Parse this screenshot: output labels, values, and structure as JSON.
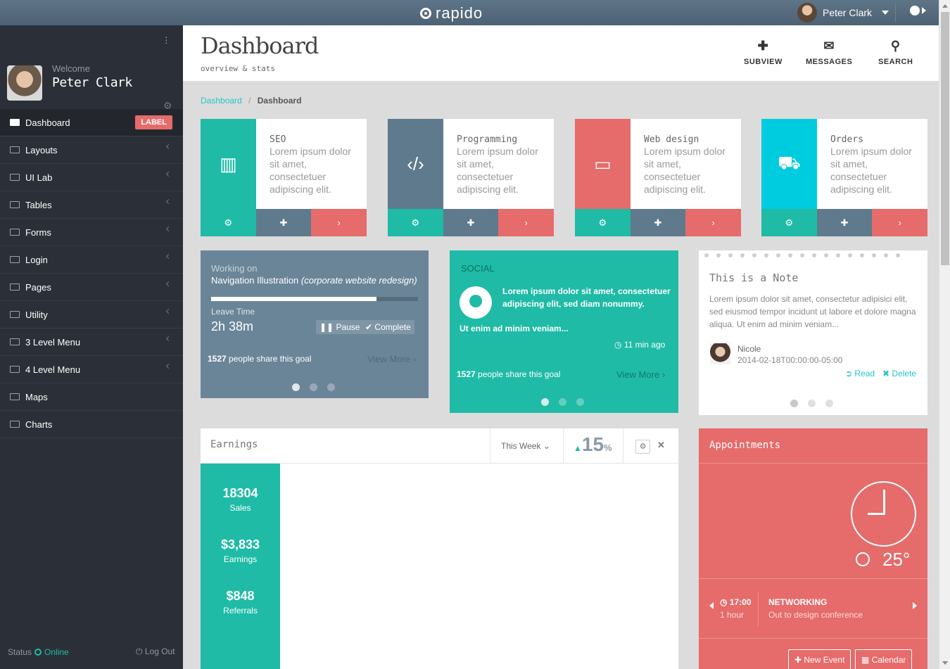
{
  "topbar": {
    "logo": "rapido",
    "user_name": "Peter Clark"
  },
  "sidebar": {
    "welcome": "Welcome",
    "user_name": "Peter Clark",
    "items": [
      {
        "label": "Dashboard",
        "badge": "LABEL",
        "active": true
      },
      {
        "label": "Layouts"
      },
      {
        "label": "UI Lab"
      },
      {
        "label": "Tables"
      },
      {
        "label": "Forms"
      },
      {
        "label": "Login"
      },
      {
        "label": "Pages"
      },
      {
        "label": "Utility"
      },
      {
        "label": "3 Level Menu"
      },
      {
        "label": "4 Level Menu"
      },
      {
        "label": "Maps"
      },
      {
        "label": "Charts"
      }
    ],
    "status_label": "Status",
    "status_value": "Online",
    "logout": "Log Out"
  },
  "header": {
    "title": "Dashboard",
    "subtitle": "overview & stats",
    "actions": [
      {
        "label": "SUBVIEW",
        "icon": "plus-icon"
      },
      {
        "label": "MESSAGES",
        "icon": "envelope-icon"
      },
      {
        "label": "SEARCH",
        "icon": "search-icon"
      }
    ]
  },
  "breadcrumb": {
    "link": "Dashboard",
    "sep": "/",
    "current": "Dashboard"
  },
  "services": [
    {
      "title": "SEO",
      "text": "Lorem ipsum dolor sit amet, consectetuer adipiscing elit.",
      "icon": "bar-chart-icon",
      "color": "#1fbba6"
    },
    {
      "title": "Programming",
      "text": "Lorem ipsum dolor sit amet, consectetuer adipiscing elit.",
      "icon": "code-icon",
      "color": "#5f7a8c"
    },
    {
      "title": "Web design",
      "text": "Lorem ipsum dolor sit amet, consectetuer adipiscing elit.",
      "icon": "monitor-icon",
      "color": "#e66b6b"
    },
    {
      "title": "Orders",
      "text": "Lorem ipsum dolor sit amet, consectetuer adipiscing elit.",
      "icon": "cart-icon",
      "color": "#00cce0"
    }
  ],
  "working": {
    "label": "Working on",
    "task": "Navigation Illustration",
    "task_detail": "(corporate website redesign)",
    "progress": 0.8,
    "leave_label": "Leave Time",
    "leave_value": "2h 38m",
    "pause": "Pause",
    "complete": "Complete",
    "share_count": "1527",
    "share_text": "people share this goal",
    "view_more": "View More"
  },
  "social": {
    "label": "SOCIAL",
    "text1": "Lorem ipsum dolor sit amet, consectetuer adipiscing elit, sed diam nonummy.",
    "text2": "Ut enim ad minim veniam...",
    "time": "11 min ago",
    "share_count": "1527",
    "share_text": "people share this goal",
    "view_more": "View More"
  },
  "note": {
    "title": "This is a Note",
    "text": "Lorem ipsum dolor sit amet, consectetur adipisici elit, sed eiusmod tempor incidunt ut labore et dolore magna aliqua. Ut enim ad minim veniam...",
    "author": "Nicole",
    "date": "2014-02-18T00:00:00-05:00",
    "read": "Read",
    "delete": "Delete"
  },
  "earnings": {
    "title": "Earnings",
    "period": "This Week",
    "percent": "15",
    "percent_unit": "%",
    "stats": [
      {
        "value": "18304",
        "label": "Sales"
      },
      {
        "value": "$3,833",
        "label": "Earnings"
      },
      {
        "value": "$848",
        "label": "Referrals"
      }
    ]
  },
  "appointments": {
    "title": "Appointments",
    "temperature": "25°",
    "event_time": "17:00",
    "event_duration": "1 hour",
    "event_title": "NETWORKING",
    "event_subtitle": "Out to design conference",
    "new_event": "New Event",
    "calendar": "Calendar"
  }
}
